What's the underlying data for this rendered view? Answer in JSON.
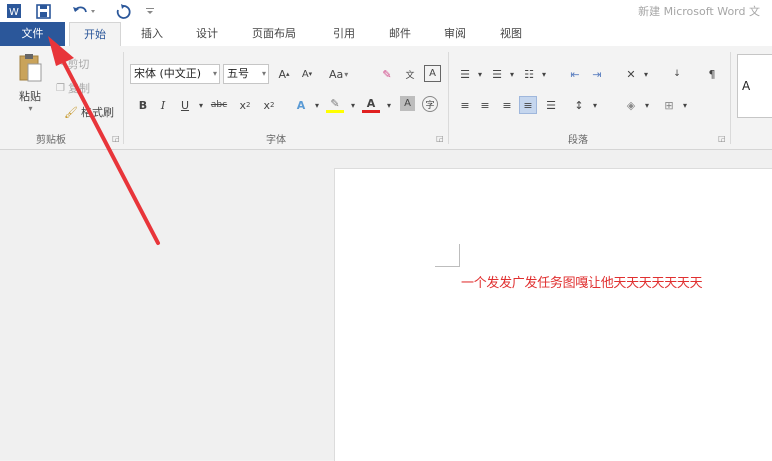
{
  "title_bar": {
    "title": "新建 Microsoft Word 文",
    "icons": [
      "word-app-icon",
      "save-icon",
      "undo-icon",
      "redo-icon",
      "customize-qat-icon"
    ]
  },
  "tabs": [
    {
      "label": "文件"
    },
    {
      "label": "开始"
    },
    {
      "label": "插入"
    },
    {
      "label": "设计"
    },
    {
      "label": "页面布局"
    },
    {
      "label": "引用"
    },
    {
      "label": "邮件"
    },
    {
      "label": "审阅"
    },
    {
      "label": "视图"
    }
  ],
  "ribbon": {
    "clipboard": {
      "paste_label": "粘贴",
      "cut_label": "剪切",
      "copy_label": "复制",
      "format_painter_label": "格式刷",
      "group_label": "剪贴板"
    },
    "font": {
      "font_name": "宋体 (中文正)",
      "font_size": "五号",
      "change_case_label": "Aa",
      "group_label": "字体"
    },
    "paragraph": {
      "group_label": "段落"
    },
    "styles": {
      "preview_letter": "A"
    }
  },
  "document": {
    "text": "一个发发广发任务图嘎让他天天天天天天天"
  },
  "colors": {
    "accent": "#2b579a",
    "annotation_arrow": "#e8353a",
    "document_text": "#e03030"
  }
}
